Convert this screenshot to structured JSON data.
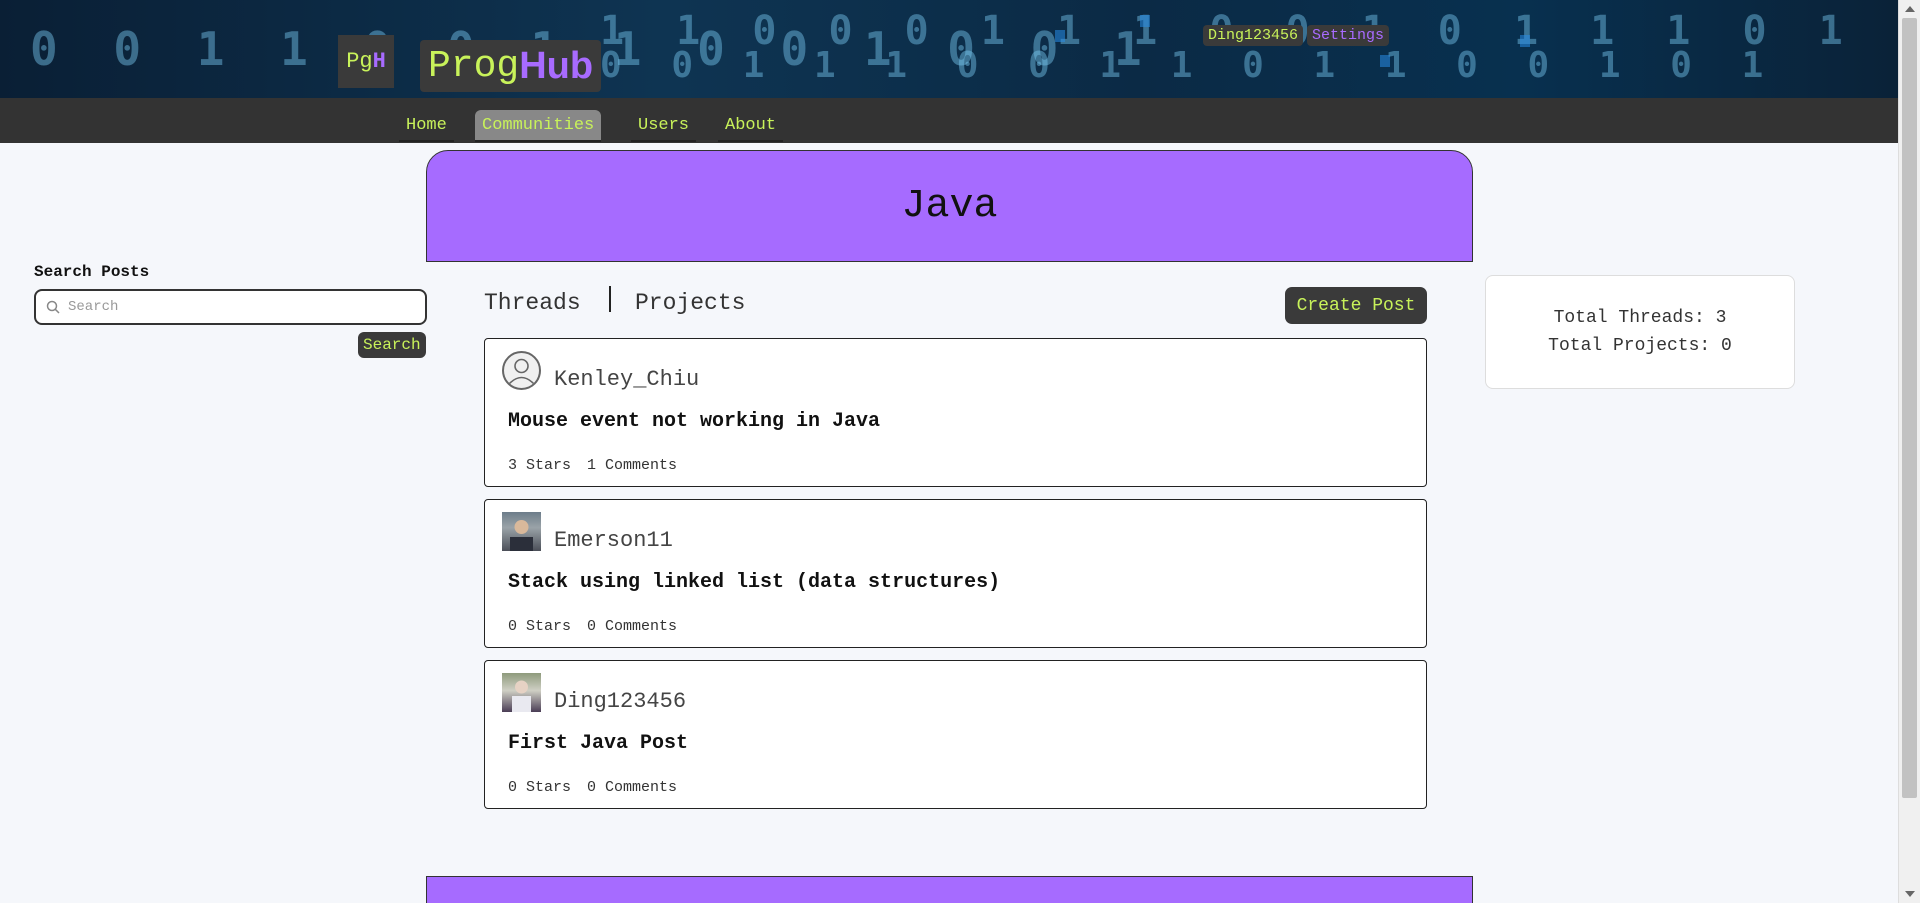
{
  "banner": {
    "logo_left": "Pg",
    "logo_right": "H",
    "brand_prefix": "Prog",
    "brand_suffix": "Hub",
    "username": "Ding123456",
    "settings_label": "Settings"
  },
  "nav": {
    "items": [
      {
        "label": "Home"
      },
      {
        "label": "Communities",
        "active": true
      },
      {
        "label": "Users"
      },
      {
        "label": "About"
      }
    ]
  },
  "community": {
    "title": "Java"
  },
  "search": {
    "label": "Search Posts",
    "placeholder": "Search",
    "value": "",
    "button_label": "Search"
  },
  "tabs": {
    "threads_label": "Threads",
    "projects_label": "Projects",
    "create_post_label": "Create Post"
  },
  "posts": [
    {
      "author": "Kenley_Chiu",
      "avatar": "default-avatar-icon",
      "title": "Mouse event not working in Java",
      "stars": "3 Stars",
      "comments": "1 Comments"
    },
    {
      "author": "Emerson11",
      "avatar": "user-photo",
      "title": "Stack using linked list (data structures)",
      "stars": "0 Stars",
      "comments": "0 Comments"
    },
    {
      "author": "Ding123456",
      "avatar": "user-photo",
      "title": "First Java Post",
      "stars": "0 Stars",
      "comments": "0 Comments"
    }
  ],
  "stats": {
    "total_threads": "Total Threads: 3",
    "total_projects": "Total Projects: 0"
  },
  "colors": {
    "accent_purple": "#a66bff",
    "accent_green": "#c8f25a",
    "dark": "#3a3a3a"
  }
}
